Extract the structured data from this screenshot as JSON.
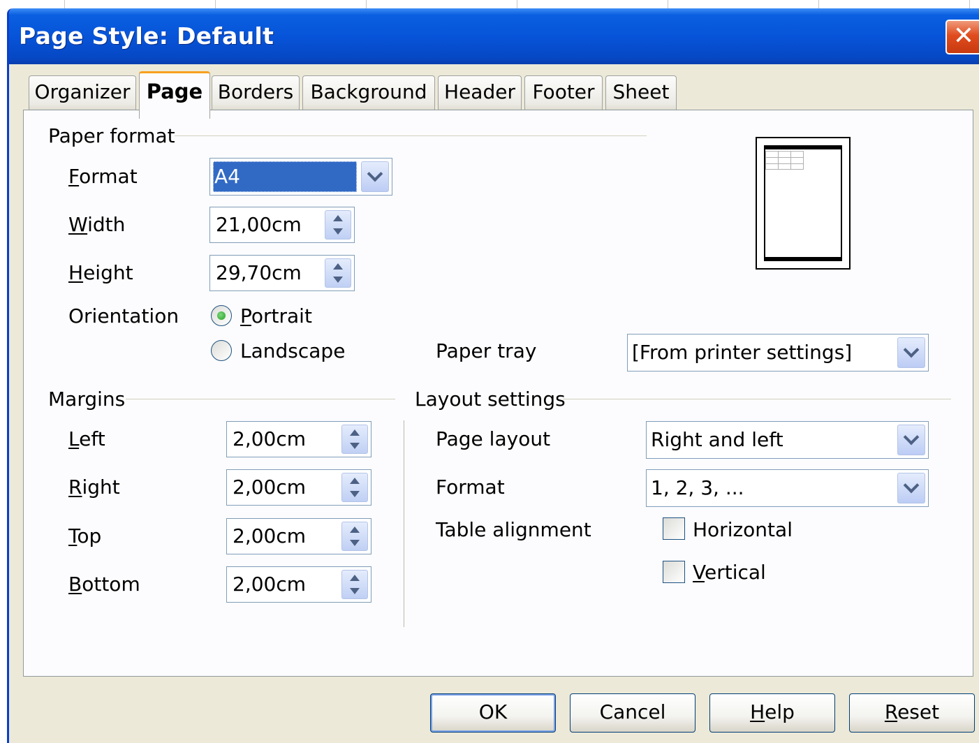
{
  "window": {
    "title": "Page Style: Default",
    "close_glyph": "✕"
  },
  "tabs": [
    {
      "label": "Organizer"
    },
    {
      "label": "Page",
      "active": true
    },
    {
      "label": "Borders"
    },
    {
      "label": "Background"
    },
    {
      "label": "Header"
    },
    {
      "label": "Footer"
    },
    {
      "label": "Sheet"
    }
  ],
  "paper_format": {
    "group_label": "Paper format",
    "format": {
      "label": "Format",
      "value": "A4"
    },
    "width": {
      "label": "Width",
      "value": "21,00cm"
    },
    "height": {
      "label": "Height",
      "value": "29,70cm"
    },
    "orientation": {
      "label": "Orientation",
      "portrait": {
        "label": "Portrait",
        "checked": true
      },
      "landscape": {
        "label": "Landscape",
        "checked": false
      }
    },
    "paper_tray": {
      "label": "Paper tray",
      "value": "[From printer settings]"
    }
  },
  "margins": {
    "group_label": "Margins",
    "left": {
      "label": "Left",
      "value": "2,00cm"
    },
    "right": {
      "label": "Right",
      "value": "2,00cm"
    },
    "top": {
      "label": "Top",
      "value": "2,00cm"
    },
    "bottom": {
      "label": "Bottom",
      "value": "2,00cm"
    }
  },
  "layout_settings": {
    "group_label": "Layout settings",
    "page_layout": {
      "label": "Page layout",
      "value": "Right and left"
    },
    "format": {
      "label": "Format",
      "value": "1, 2, 3, ..."
    },
    "table_alignment": {
      "label": "Table alignment",
      "horizontal": {
        "label": "Horizontal",
        "checked": false
      },
      "vertical": {
        "label": "Vertical",
        "checked": false
      }
    }
  },
  "buttons": {
    "ok": "OK",
    "cancel": "Cancel",
    "help": "Help",
    "reset": "Reset"
  },
  "colors": {
    "titlebar": "#0754d9",
    "dialog_bg": "#ece9d8",
    "selection": "#316ac5",
    "active_tab_accent": "#f8a020",
    "close_button": "#e04c1e"
  }
}
